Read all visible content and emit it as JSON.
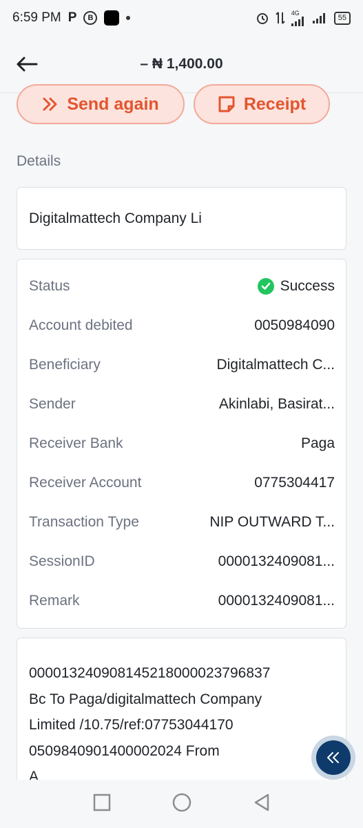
{
  "status_bar": {
    "time": "6:59 PM",
    "p_label": "P",
    "b_label": "B",
    "battery": "55",
    "network": "4G"
  },
  "header": {
    "amount": "– ₦ 1,400.00"
  },
  "actions": {
    "send_again": "Send again",
    "receipt": "Receipt"
  },
  "details_label": "Details",
  "name_card": "Digitalmattech Company Li",
  "details": {
    "status_label": "Status",
    "status_value": "Success",
    "rows": [
      {
        "label": "Account debited",
        "value": "0050984090"
      },
      {
        "label": "Beneficiary",
        "value": "Digitalmattech C..."
      },
      {
        "label": "Sender",
        "value": "Akinlabi, Basirat..."
      },
      {
        "label": "Receiver Bank",
        "value": "Paga"
      },
      {
        "label": "Receiver Account",
        "value": "0775304417"
      },
      {
        "label": "Transaction Type",
        "value": "NIP OUTWARD T..."
      },
      {
        "label": "SessionID",
        "value": "0000132409081..."
      },
      {
        "label": "Remark",
        "value": "0000132409081..."
      }
    ]
  },
  "remark_full": {
    "line1": "000013240908145218000023796837",
    "line2": "Bc To Paga/digitalmattech Company",
    "line3": "Limited /10.75/ref:07753044170",
    "line4": "0509840901400002024 From",
    "line5": "A"
  },
  "colors": {
    "accent": "#e2552f",
    "accent_bg": "#fde3dd",
    "success": "#22c55e",
    "fab": "#0e3b6b"
  }
}
